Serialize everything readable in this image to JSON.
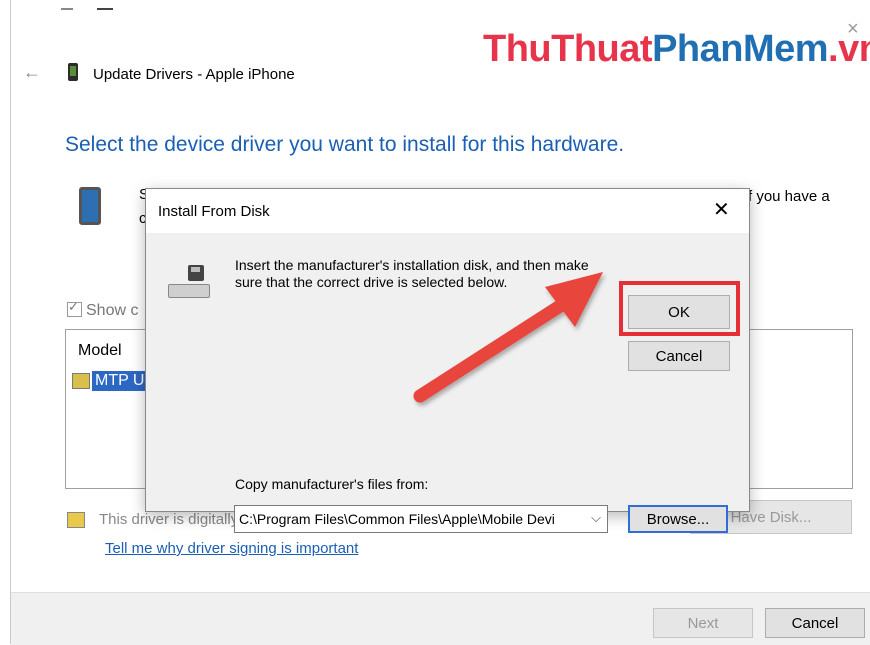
{
  "brand": {
    "part1": "ThuThuat",
    "part2": "PhanMem",
    "part3": ".vn",
    "color_red": "#e8344a",
    "color_blue": "#1f6fb2"
  },
  "wizard": {
    "title": "Update Drivers - Apple iPhone",
    "heading": "Select the device driver you want to install for this hardware.",
    "fragment_s": "S",
    "fragment_c": "c",
    "fragment_right": "f you have a",
    "show_compatible": "Show c",
    "model_header": "Model",
    "model_item": "MTP U",
    "signed_text": "This driver is digitally signed.",
    "sign_link": "Tell me why driver signing is important",
    "have_disk": "Have Disk...",
    "next": "Next",
    "cancel": "Cancel",
    "heading_color": "#1a5fb4"
  },
  "dialog": {
    "title": "Install From Disk",
    "instruction": "Insert the manufacturer's installation disk, and then make sure that the correct drive is selected below.",
    "ok": "OK",
    "cancel": "Cancel",
    "copy_label": "Copy manufacturer's files from:",
    "path_value": "C:\\Program Files\\Common Files\\Apple\\Mobile Devi",
    "browse": "Browse...",
    "highlight_color": "#e32f35"
  },
  "icons": {
    "back": "back-arrow-icon",
    "device": "phone-icon",
    "close": "close-icon",
    "disk": "disk-drive-icon",
    "chevron": "chevron-down-icon",
    "driver": "driver-icon",
    "certificate": "certificate-icon"
  }
}
